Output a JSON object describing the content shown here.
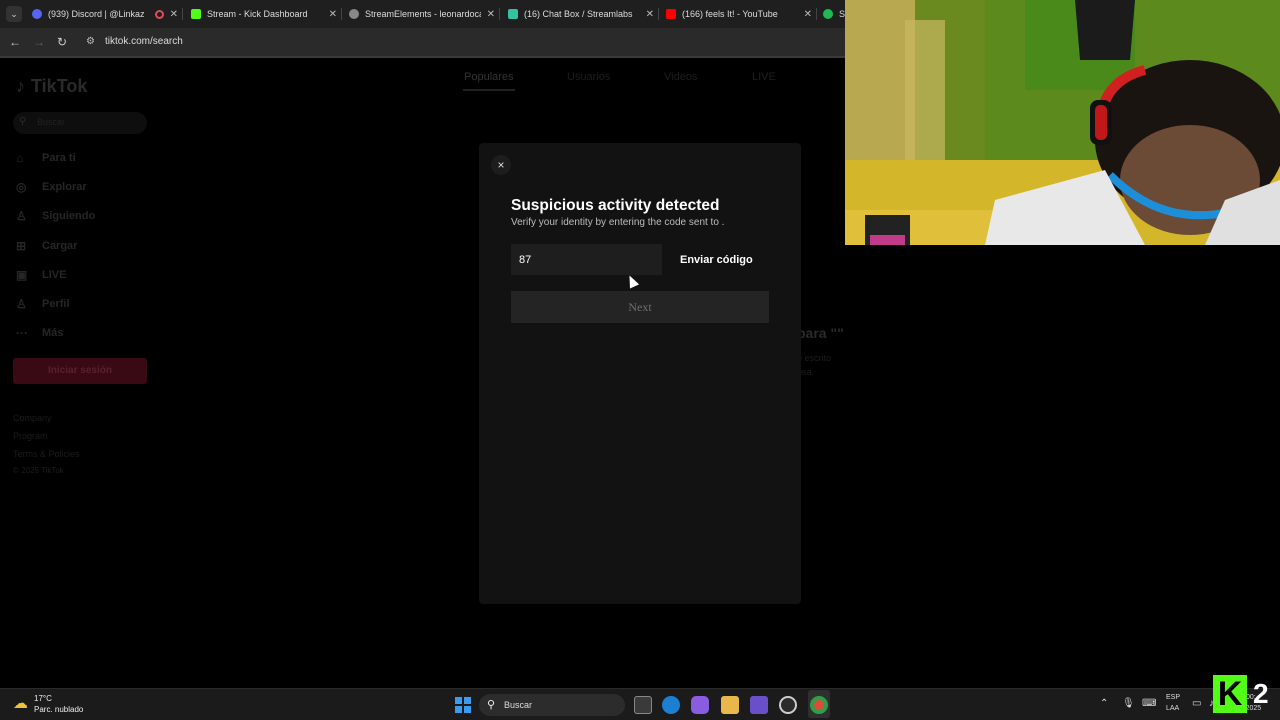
{
  "browser": {
    "tabs": [
      {
        "label": "(939) Discord | @Linkaz",
        "favicon_color": "#5865f2",
        "close": "✕"
      },
      {
        "label": "Stream - Kick Dashboard",
        "favicon_color": "#53fc18",
        "close": "✕"
      },
      {
        "label": "StreamElements - leonardocam",
        "favicon_color": "#888888",
        "close": "✕"
      },
      {
        "label": "(16) Chat Box / Streamlabs",
        "favicon_color": "#31c3a2",
        "close": "✕"
      },
      {
        "label": "(166) feels It! - YouTube",
        "favicon_color": "#ff0000",
        "close": "✕"
      },
      {
        "label": "Sp",
        "favicon_color": "#1db954",
        "close": ""
      }
    ],
    "record_indicator_color": "#e24b5c",
    "address": "tiktok.com/search"
  },
  "tiktok": {
    "logo": "TikTok",
    "search_placeholder": "Buscar",
    "sidebar": [
      {
        "icon": "home-icon",
        "glyph": "⌂",
        "label": "Para ti"
      },
      {
        "icon": "compass-icon",
        "glyph": "◎",
        "label": "Explorar"
      },
      {
        "icon": "following-icon",
        "glyph": "♙",
        "label": "Siguiendo"
      },
      {
        "icon": "upload-icon",
        "glyph": "⊞",
        "label": "Cargar"
      },
      {
        "icon": "live-icon",
        "glyph": "▣",
        "label": "LIVE"
      },
      {
        "icon": "profile-icon",
        "glyph": "♙",
        "label": "Perfil"
      },
      {
        "icon": "more-icon",
        "glyph": "···",
        "label": "Más"
      }
    ],
    "login_button": "Iniciar sesión",
    "footer": [
      "Company",
      "Program",
      "Terms & Policies",
      "© 2025 TikTok"
    ],
    "search_tabs": [
      "Populares",
      "Usuarios",
      "Videos",
      "LIVE"
    ],
    "no_results_title": "para \"\"",
    "no_results_line1": "ó escrito",
    "no_results_line2": "osa."
  },
  "modal": {
    "close_label": "×",
    "title": "Suspicious activity detected",
    "subtitle": "Verify your identity by entering the code sent to .",
    "code_value": "87",
    "send_code_label": "Enviar código",
    "next_label": "Next"
  },
  "taskbar": {
    "weather_temp": "17°C",
    "weather_desc": "Parc. nublado",
    "search_placeholder": "Buscar",
    "lang_line1": "ESP",
    "lang_line2": "LAA",
    "time": "00:",
    "date": "2/10/2025"
  },
  "overlay": {
    "kick_letter": "K",
    "kick_number": "2"
  }
}
